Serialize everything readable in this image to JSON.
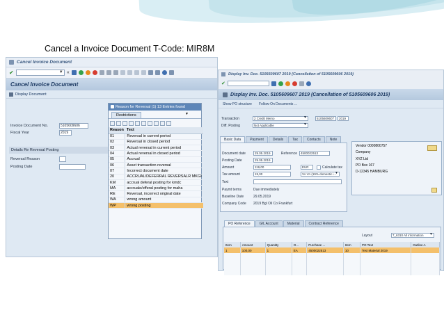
{
  "slide": {
    "title": "Cancel a Invoice Document T-Code: MIR8M"
  },
  "left_window": {
    "menu_title": "Cancel Invoice Document",
    "title": "Cancel Invoice Document",
    "app_toolbar": {
      "display_document": "Display Document"
    },
    "fields": {
      "invoice_doc_label": "Invoice Document No.",
      "invoice_doc_value": "5105609606",
      "fiscal_year_label": "Fiscal Year",
      "fiscal_year_value": "2019"
    },
    "group": {
      "title": "Details Re Reversal Posting",
      "reversal_reason_label": "Reversal Reason",
      "reversal_reason_value": "",
      "posting_date_label": "Posting Date",
      "posting_date_value": ""
    }
  },
  "popup": {
    "title": "Reason for Reversal (1)  13 Entries found",
    "tab": "Restrictions",
    "col_reason": "Reason",
    "col_text": "Text",
    "rows": [
      {
        "code": "01",
        "text": "Reversal in current period"
      },
      {
        "code": "02",
        "text": "Reversal in closed period"
      },
      {
        "code": "03",
        "text": "Actual reversal in current period"
      },
      {
        "code": "04",
        "text": "Actual reversal in closed period"
      },
      {
        "code": "05",
        "text": "Accrual"
      },
      {
        "code": "06",
        "text": "Asset transaction reversal"
      },
      {
        "code": "07",
        "text": "Incorrect document date"
      },
      {
        "code": "20",
        "text": "ACCRUAL/DEFERRAL REVERSALR MKGI"
      },
      {
        "code": "KM",
        "text": "accrual deferal posting for kmdc"
      },
      {
        "code": "MA",
        "text": "accruale/efferal posting for maha"
      },
      {
        "code": "RE",
        "text": "Reversal, incorrect original date"
      },
      {
        "code": "WA",
        "text": "wrong amount"
      },
      {
        "code": "WP",
        "text": "wrong posting"
      }
    ],
    "selected_code": "WP"
  },
  "right_window": {
    "title": "Display Inv. Doc. 5105609607 2019 (Cancellation of 5105609606 2019)",
    "header_title": "Display Inv. Doc. 5105609607 2019 (Cancellation of 5105609606 2019)",
    "app_toolbar": {
      "show_po": "Show PO structure",
      "follow_on": "Follow-On Documents ..."
    },
    "transaction_label": "Transaction",
    "transaction_value": "2 Credit Memo",
    "transaction_doc": "5105609607",
    "transaction_year": "2019",
    "diff_posting_label": "Diff. Posting",
    "diff_posting_value": "Not Applicable",
    "tabs": [
      "Basic Data",
      "Payment",
      "Details",
      "Tax",
      "Contacts",
      "Note"
    ],
    "basic": {
      "doc_date_label": "Document date",
      "doc_date_value": "29.05.2019",
      "reference_label": "Reference",
      "reference_value": "4500022513",
      "posting_date_label": "Posting Date",
      "posting_date_value": "29.05.2019",
      "amount_label": "Amount",
      "amount_value": "119,00",
      "currency": "EUR",
      "calc_tax_label": "Calculate tax",
      "tax_amount_label": "Tax amount",
      "tax_amount_value": "19,00",
      "tax_code": "VA VA (19% domestic i...",
      "text_label": "Text",
      "paymt_terms_label": "Paymt terms",
      "paymt_terms_value": "Due immediately",
      "baseline_label": "Baseline Date",
      "baseline_value": "29.05.2019",
      "company_label": "Company Code",
      "company_value": "2019 Bgl Oil Co Frankfurt"
    },
    "vendor": {
      "title": "Vendor 0000800757",
      "company": "Company",
      "name": "XYZ Ltd",
      "po_box": "PO Box 167",
      "city": "D-12345 HAMBURG"
    },
    "bottom_tabs": [
      "PO Reference",
      "G/L Account",
      "Material",
      "Contract Reference"
    ],
    "layout_label": "Layout",
    "layout_value": "7_6310 All information",
    "grid_cols": [
      "Item",
      "Amount",
      "Quantity",
      "O...",
      "Purchase ...",
      "Item",
      "PO Text",
      "Outline A"
    ],
    "grid_rows": [
      [
        "1",
        "100,00",
        "1",
        "EA",
        "4500022513",
        "10",
        "Test Material 2019",
        ""
      ]
    ]
  }
}
